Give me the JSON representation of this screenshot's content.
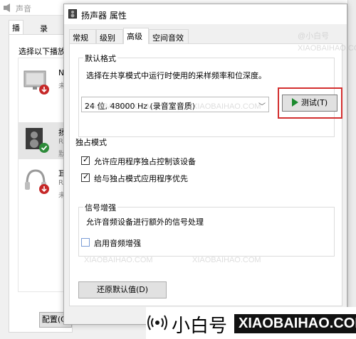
{
  "background_window": {
    "title": "声音",
    "tabs": [
      {
        "label": "播放",
        "active": true
      },
      {
        "label": "录制",
        "active": false
      }
    ],
    "instruction": "选择以下播放",
    "devices": [
      {
        "name": "NV",
        "line1": "未插",
        "icon": "monitor-icon",
        "status": "red-arrow",
        "selected": false
      },
      {
        "name": "扬声",
        "line1": "Rea",
        "line2": "默认",
        "icon": "speaker-icon",
        "status": "green-check",
        "selected": true
      },
      {
        "name": "耳机",
        "line1": "Rea",
        "line2": "未插",
        "icon": "headphones-icon",
        "status": "red-arrow",
        "selected": false
      }
    ],
    "configure_button": "配置(C)"
  },
  "dialog": {
    "title": "扬声器 属性",
    "tabs": [
      {
        "label": "常规",
        "active": false
      },
      {
        "label": "级别",
        "active": false
      },
      {
        "label": "高级",
        "active": true
      },
      {
        "label": "空间音效",
        "active": false
      }
    ],
    "default_format": {
      "group_label": "默认格式",
      "description": "选择在共享模式中运行时使用的采样频率和位深度。",
      "selected": "24 位, 48000 Hz (录音室音质)",
      "test_button": "测试(T)"
    },
    "exclusive_mode": {
      "group_label": "独占模式",
      "options": [
        {
          "label": "允许应用程序独占控制该设备",
          "checked": true
        },
        {
          "label": "给与独占模式应用程序优先",
          "checked": true
        }
      ]
    },
    "signal_enhancement": {
      "group_label": "信号增强",
      "description": "允许音频设备进行额外的信号处理",
      "option": {
        "label": "启用音频增强",
        "checked": false
      }
    },
    "restore_button": "还原默认值(D)"
  },
  "watermark": {
    "text_cn": "@小白号",
    "text_en": "XIAOBAIHAO.COM"
  },
  "brand": {
    "name_cn": "小白号",
    "name_en": "XIAOBAIHAO.COM"
  },
  "colors": {
    "highlight": "#d32f2f",
    "play_green": "#1b8a2e",
    "selected_row": "#e5e5e5"
  }
}
